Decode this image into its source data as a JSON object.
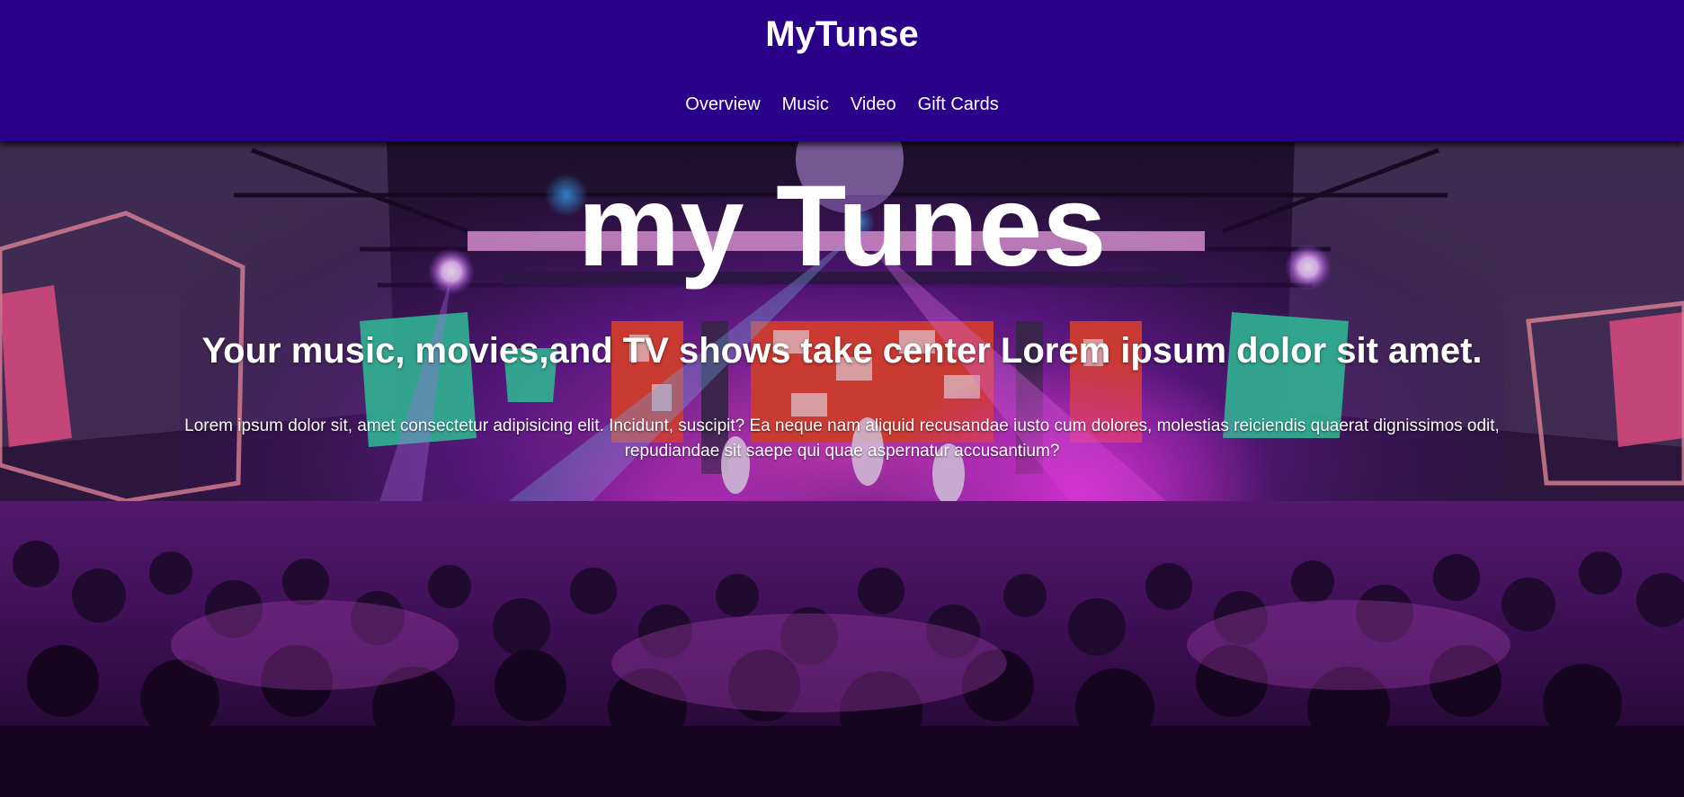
{
  "header": {
    "brand": "MyTunse",
    "nav": [
      {
        "label": "Overview"
      },
      {
        "label": "Music"
      },
      {
        "label": "Video"
      },
      {
        "label": "Gift Cards"
      }
    ]
  },
  "hero": {
    "title": "my Tunes",
    "subtitle": "Your music, movies,and TV shows take center Lorem ipsum dolor sit amet.",
    "body": "Lorem ipsum dolor sit, amet consectetur adipisicing elit. Incidunt, suscipit? Ea neque nam aliquid recusandae iusto cum dolores, molestias reiciendis quaerat dignissimos odit, repudiandae sit saepe qui quae aspernatur accusantium?",
    "background": "concert crowd photo with purple and magenta stage lighting"
  },
  "colors": {
    "header_bg": "#2a0088",
    "text": "#ffffff",
    "accent_magenta": "#e030e0",
    "accent_green": "#30e0a8"
  }
}
